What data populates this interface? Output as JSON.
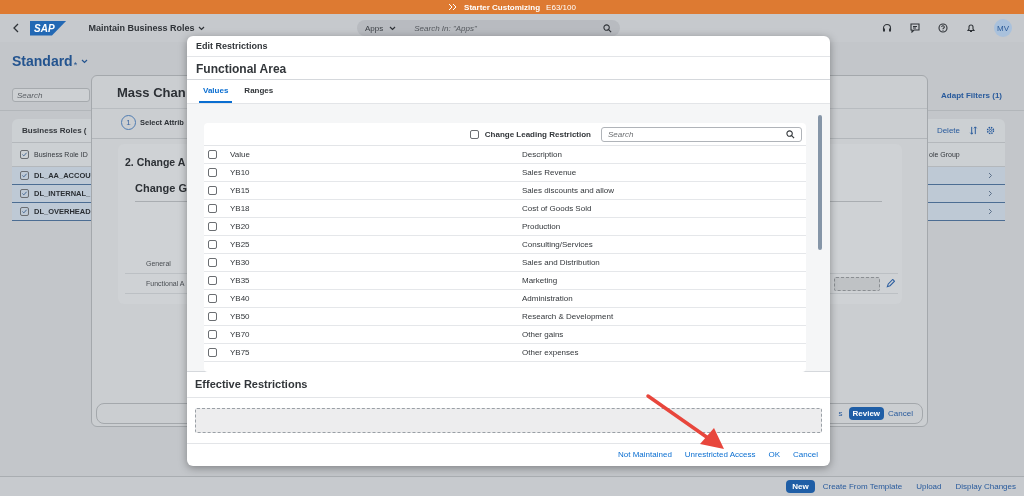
{
  "top_bar": {
    "title": "Starter Customizing",
    "system": "E63/100"
  },
  "shell": {
    "logo": "SAP",
    "app_title": "Maintain Business Roles",
    "search_scope": "Apps",
    "search_placeholder": "Search In: \"Apps\"",
    "avatar": "MV"
  },
  "variant": {
    "name": "Standard",
    "mark": "*"
  },
  "filter_bar": {
    "search_placeholder": "Search",
    "adapt_filters": "Adapt Filters (1)"
  },
  "table": {
    "title": "Business Roles (",
    "actions": [
      "Delete"
    ],
    "columns": [
      "Business Role ID",
      "ole Group"
    ],
    "all_selected": true,
    "rows": [
      {
        "id": "DL_AA_ACCOU",
        "selected": true
      },
      {
        "id": "DL_INTERNAL_",
        "selected": true
      },
      {
        "id": "DL_OVERHEAD",
        "selected": true
      }
    ]
  },
  "footer": {
    "buttons": [
      {
        "label": "New",
        "kind": "emphasized"
      },
      {
        "label": "Create From Template",
        "kind": "transparent"
      },
      {
        "label": "Upload",
        "kind": "transparent"
      },
      {
        "label": "Display Changes",
        "kind": "transparent"
      }
    ]
  },
  "mass_change": {
    "title": "Mass Chan",
    "steps": [
      {
        "number": "1",
        "label": "Select Attrib"
      }
    ],
    "section_title": "2. Change A",
    "group_title": "Change G",
    "rows": [
      {
        "label": "General",
        "editable": false
      },
      {
        "label": "Functional A",
        "editable": true
      }
    ],
    "footer_buttons": [
      {
        "label": "s",
        "kind": "transparent"
      },
      {
        "label": "Review",
        "kind": "emphasized"
      },
      {
        "label": "Cancel",
        "kind": "transparent"
      }
    ]
  },
  "edit_restrictions": {
    "title": "Edit Restrictions",
    "field": "Functional Area",
    "tabs": [
      {
        "label": "Values",
        "selected": true
      },
      {
        "label": "Ranges",
        "selected": false
      }
    ],
    "change_leading": {
      "label": "Change Leading Restriction",
      "checked": false
    },
    "search_placeholder": "Search",
    "columns": [
      "Value",
      "Description"
    ],
    "select_all": false,
    "rows": [
      {
        "value": "YB10",
        "description": "Sales Revenue",
        "checked": false
      },
      {
        "value": "YB15",
        "description": "Sales discounts and allow",
        "checked": false
      },
      {
        "value": "YB18",
        "description": "Cost of Goods Sold",
        "checked": false
      },
      {
        "value": "YB20",
        "description": "Production",
        "checked": false
      },
      {
        "value": "YB25",
        "description": "Consulting/Services",
        "checked": false
      },
      {
        "value": "YB30",
        "description": "Sales and Distribution",
        "checked": false
      },
      {
        "value": "YB35",
        "description": "Marketing",
        "checked": false
      },
      {
        "value": "YB40",
        "description": "Administration",
        "checked": false
      },
      {
        "value": "YB50",
        "description": "Research & Development",
        "checked": false
      },
      {
        "value": "YB70",
        "description": "Other gains",
        "checked": false
      },
      {
        "value": "YB75",
        "description": "Other expenses",
        "checked": false
      }
    ],
    "effective_title": "Effective Restrictions",
    "buttons": [
      {
        "label": "Not Maintained",
        "kind": "transparent"
      },
      {
        "label": "Unrestricted Access",
        "kind": "transparent"
      },
      {
        "label": "OK",
        "kind": "transparent"
      },
      {
        "label": "Cancel",
        "kind": "transparent"
      }
    ]
  }
}
